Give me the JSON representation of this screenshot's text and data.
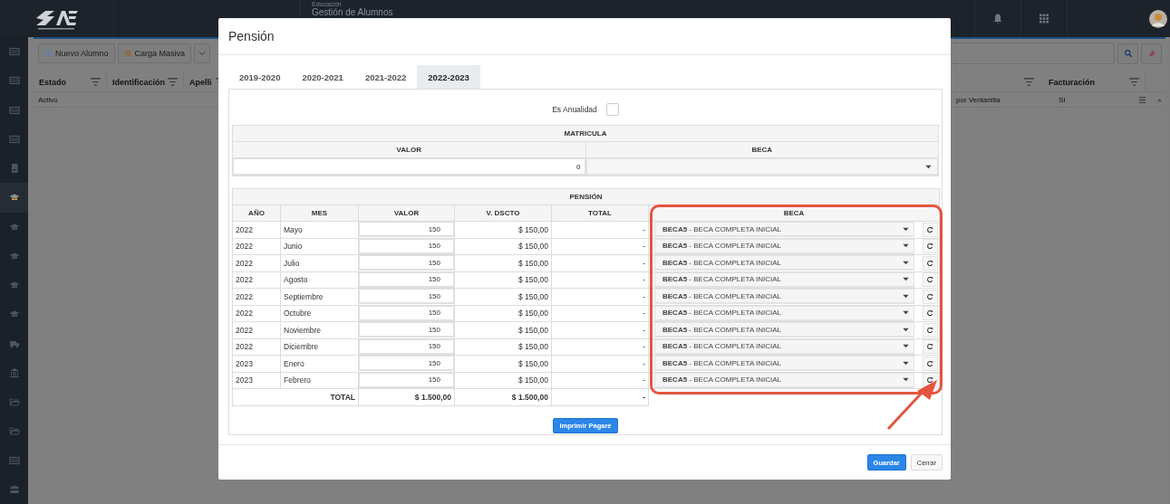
{
  "app": {
    "section": "Educación",
    "title": "Gestión de Alumnos"
  },
  "sidebar": {
    "items": [
      {
        "kind": "card",
        "selected": false
      },
      {
        "kind": "card",
        "selected": false
      },
      {
        "kind": "card",
        "selected": false
      },
      {
        "kind": "card",
        "selected": false
      },
      {
        "kind": "book",
        "selected": false
      },
      {
        "kind": "cap",
        "selected": true
      },
      {
        "kind": "cap",
        "selected": false
      },
      {
        "kind": "cap",
        "selected": false
      },
      {
        "kind": "cap",
        "selected": false
      },
      {
        "kind": "cap",
        "selected": false
      },
      {
        "kind": "truck",
        "selected": false
      },
      {
        "kind": "bank",
        "selected": false
      },
      {
        "kind": "folder",
        "selected": false
      },
      {
        "kind": "folder",
        "selected": false
      },
      {
        "kind": "card",
        "selected": false
      },
      {
        "kind": "group",
        "selected": false
      }
    ]
  },
  "toolbar": [
    {
      "label": "Nuevo Alumno"
    },
    {
      "label": "Carga Masiva"
    }
  ],
  "background_table": {
    "columns": [
      "Estado",
      "Identificación",
      "Apelli"
    ],
    "right_columns": [
      "Facturación"
    ],
    "row_left": "Activo",
    "row_right": [
      "por Ventanilla",
      "SI"
    ]
  },
  "modal": {
    "title": "Pensión",
    "tabs": [
      {
        "label": "2019-2020",
        "selected": false
      },
      {
        "label": "2020-2021",
        "selected": false
      },
      {
        "label": "2021-2022",
        "selected": false
      },
      {
        "label": "2022-2023",
        "selected": true
      }
    ],
    "annual": {
      "label": "Es Anualidad",
      "checked": false
    },
    "matricula": {
      "title": "MATRICULA",
      "columns": [
        "VALOR",
        "BECA"
      ],
      "value": "0"
    },
    "pension": {
      "title": "PENSIÓN",
      "columns": [
        "AÑO",
        "MES",
        "VALOR",
        "V. DSCTO",
        "TOTAL",
        "BECA"
      ],
      "rows": [
        {
          "year": "2022",
          "month": "Mayo",
          "value": "150",
          "discount": "$ 150,00",
          "total": "-",
          "beca": "**BECA5** - BECA COMPLETA INICIAL"
        },
        {
          "year": "2022",
          "month": "Junio",
          "value": "150",
          "discount": "$ 150,00",
          "total": "-",
          "beca": "**BECA5** - BECA COMPLETA INICIAL"
        },
        {
          "year": "2022",
          "month": "Julio",
          "value": "150",
          "discount": "$ 150,00",
          "total": "-",
          "beca": "**BECA5** - BECA COMPLETA INICIAL"
        },
        {
          "year": "2022",
          "month": "Agosto",
          "value": "150",
          "discount": "$ 150,00",
          "total": "-",
          "beca": "**BECA5** - BECA COMPLETA INICIAL"
        },
        {
          "year": "2022",
          "month": "Septiembre",
          "value": "150",
          "discount": "$ 150,00",
          "total": "-",
          "beca": "**BECA5** - BECA COMPLETA INICIAL"
        },
        {
          "year": "2022",
          "month": "Octubre",
          "value": "150",
          "discount": "$ 150,00",
          "total": "-",
          "beca": "**BECA5** - BECA COMPLETA INICIAL"
        },
        {
          "year": "2022",
          "month": "Noviembre",
          "value": "150",
          "discount": "$ 150,00",
          "total": "-",
          "beca": "**BECA5** - BECA COMPLETA INICIAL"
        },
        {
          "year": "2022",
          "month": "Diciembre",
          "value": "150",
          "discount": "$ 150,00",
          "total": "-",
          "beca": "**BECA5** - BECA COMPLETA INICIAL"
        },
        {
          "year": "2023",
          "month": "Enero",
          "value": "150",
          "discount": "$ 150,00",
          "total": "-",
          "beca": "**BECA5** - BECA COMPLETA INICIAL"
        },
        {
          "year": "2023",
          "month": "Febrero",
          "value": "150",
          "discount": "$ 150,00",
          "total": "-",
          "beca": "**BECA5** - BECA COMPLETA INICIAL"
        }
      ],
      "totals": {
        "label": "TOTAL",
        "value": "$ 1.500,00",
        "discount": "$ 1.500,00",
        "total": "-"
      }
    },
    "print_button": "Imprimir Pagaré",
    "buttons": [
      {
        "label": "Guardar",
        "kind": "primary"
      },
      {
        "label": "Cerrar",
        "kind": "default"
      }
    ]
  }
}
